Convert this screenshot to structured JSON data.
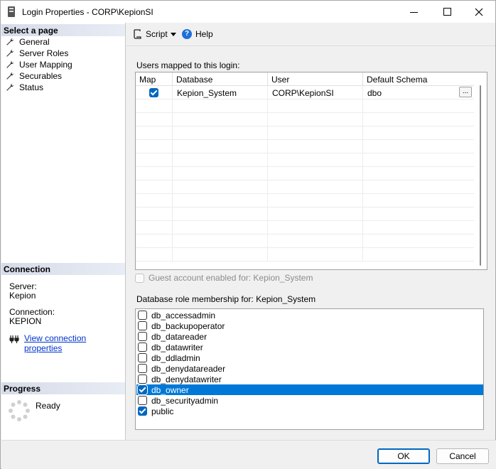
{
  "window": {
    "title": "Login Properties - CORP\\KepionSI"
  },
  "left": {
    "select_page_header": "Select a page",
    "pages": [
      {
        "label": "General"
      },
      {
        "label": "Server Roles"
      },
      {
        "label": "User Mapping"
      },
      {
        "label": "Securables"
      },
      {
        "label": "Status"
      }
    ],
    "connection_header": "Connection",
    "server_label": "Server:",
    "server_value": "Kepion",
    "connection_label": "Connection:",
    "connection_value": "KEPION",
    "view_link": "View connection properties",
    "progress_header": "Progress",
    "progress_status": "Ready"
  },
  "toolbar": {
    "script_label": "Script",
    "help_label": "Help"
  },
  "users_mapped": {
    "label": "Users mapped to this login:",
    "columns": [
      "Map",
      "Database",
      "User",
      "Default Schema"
    ],
    "rows": [
      {
        "map": true,
        "database": "Kepion_System",
        "user": "CORP\\KepionSI",
        "schema": "dbo"
      }
    ],
    "ellipsis": "..."
  },
  "guest": {
    "label": "Guest account enabled for: Kepion_System",
    "checked": false,
    "enabled": false
  },
  "roles": {
    "label": "Database role membership for: Kepion_System",
    "items": [
      {
        "name": "db_accessadmin",
        "checked": false
      },
      {
        "name": "db_backupoperator",
        "checked": false
      },
      {
        "name": "db_datareader",
        "checked": false
      },
      {
        "name": "db_datawriter",
        "checked": false
      },
      {
        "name": "db_ddladmin",
        "checked": false
      },
      {
        "name": "db_denydatareader",
        "checked": false
      },
      {
        "name": "db_denydatawriter",
        "checked": false
      },
      {
        "name": "db_owner",
        "checked": true,
        "selected": true
      },
      {
        "name": "db_securityadmin",
        "checked": false
      },
      {
        "name": "public",
        "checked": true
      }
    ]
  },
  "buttons": {
    "ok": "OK",
    "cancel": "Cancel"
  },
  "colors": {
    "selection": "#0078d7",
    "link": "#0033cc",
    "checkbox": "#0067c0"
  }
}
